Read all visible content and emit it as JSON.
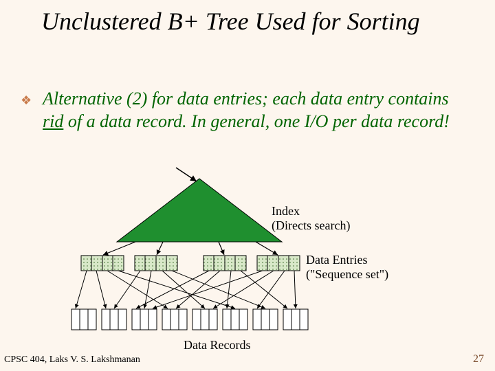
{
  "title": "Unclustered B+ Tree Used for Sorting",
  "bullet": {
    "parts": [
      "Alternative (2) for data entries; each data entry contains ",
      "rid",
      " of a data record.  In general, one I/O per data record!"
    ]
  },
  "labels": {
    "index": [
      "Index",
      "(Directs search)"
    ],
    "entries": [
      "Data Entries",
      "(\"Sequence set\")"
    ],
    "records": "Data Records"
  },
  "footer": "CPSC 404, Laks V. S. Lakshmanan",
  "page": "27",
  "colors": {
    "triangle": "#1f8f2f",
    "bulletText": "#006400",
    "bulletMark": "#c97a4a"
  }
}
